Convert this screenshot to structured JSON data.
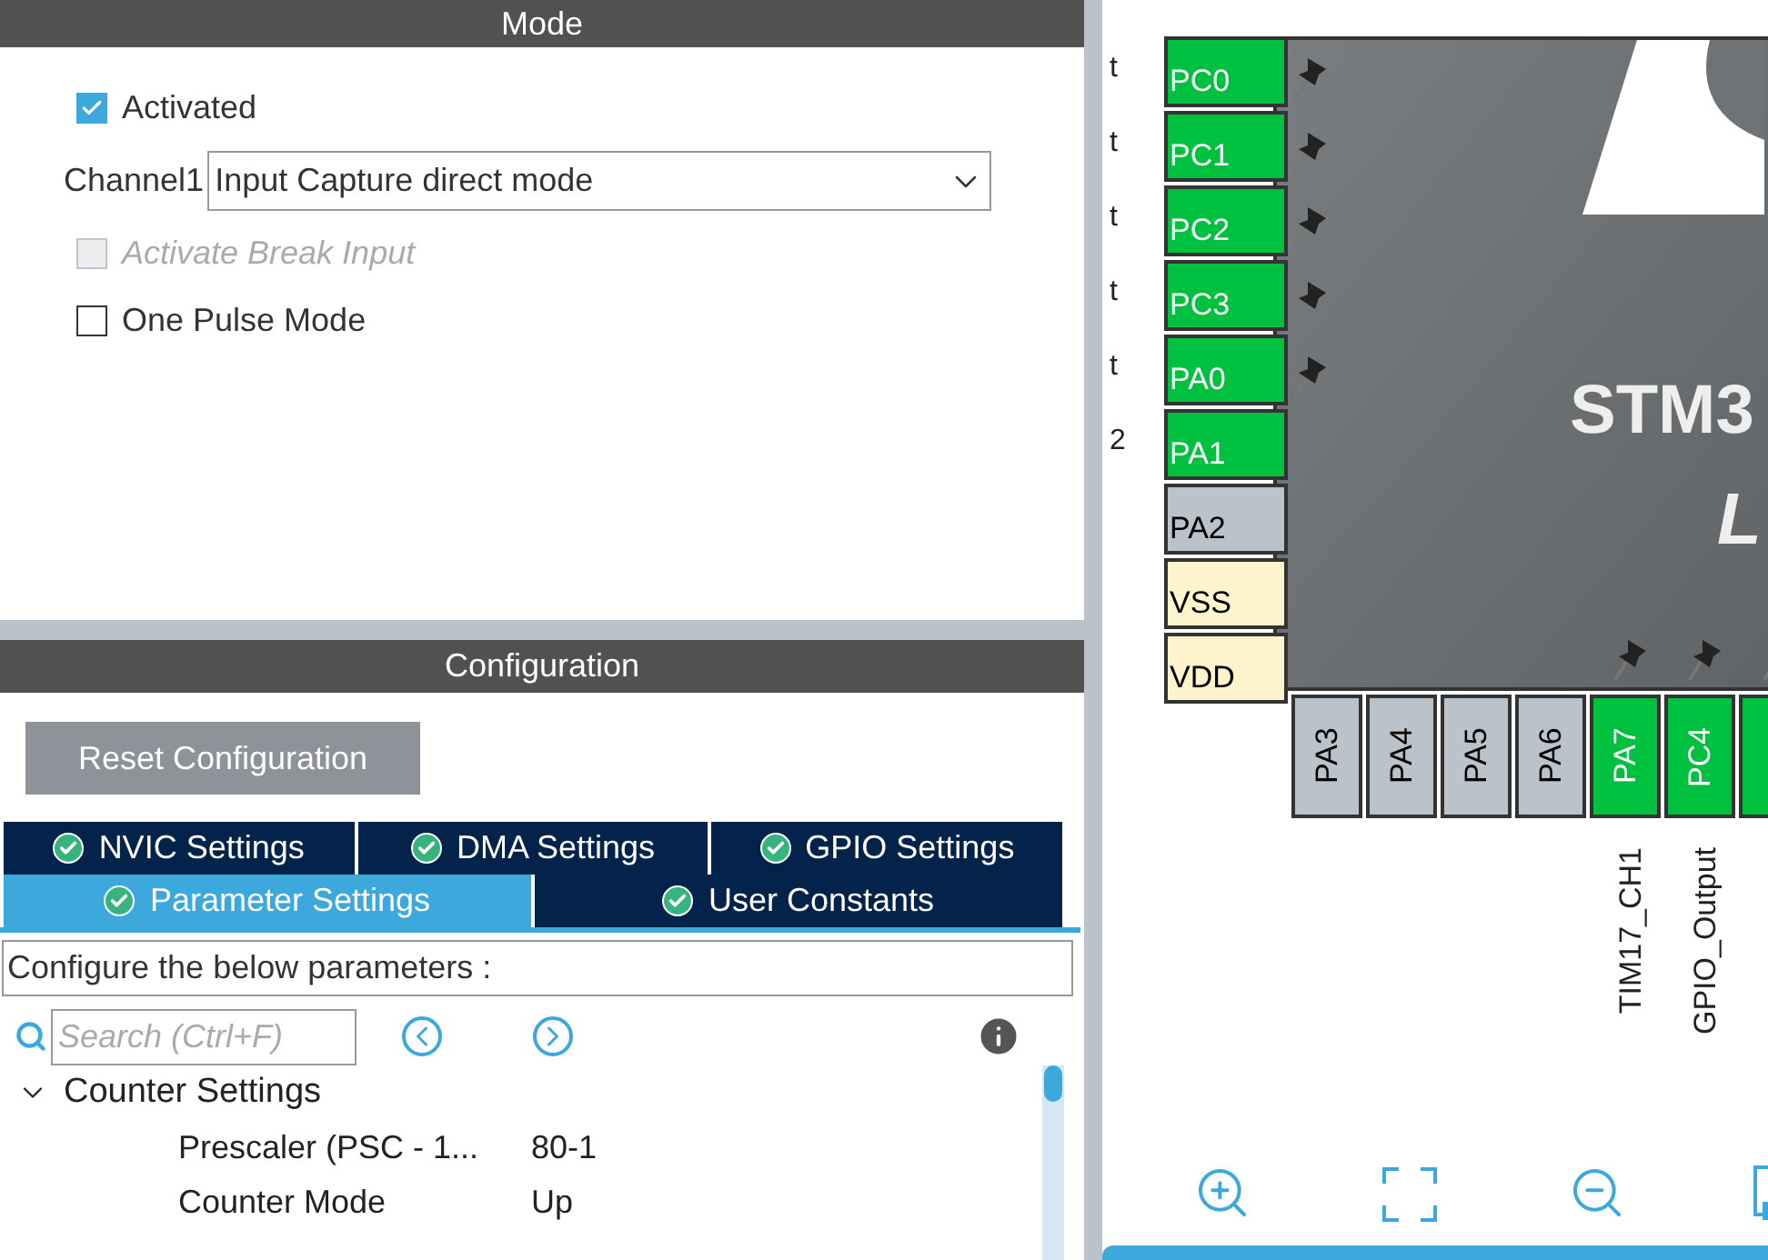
{
  "mode": {
    "title": "Mode",
    "activated": {
      "label": "Activated",
      "checked": true
    },
    "channel": {
      "label": "Channel1",
      "value": "Input Capture direct mode"
    },
    "options": [
      {
        "label": "Activate Break Input",
        "checked": false,
        "disabled": true
      },
      {
        "label": "One Pulse Mode",
        "checked": false,
        "disabled": false
      }
    ]
  },
  "configuration": {
    "title": "Configuration",
    "reset_button": "Reset Configuration",
    "tabs": [
      [
        {
          "label": "NVIC Settings",
          "selected": false
        },
        {
          "label": "DMA Settings",
          "selected": false
        },
        {
          "label": "GPIO Settings",
          "selected": false
        }
      ],
      [
        {
          "label": "Parameter Settings",
          "selected": true
        },
        {
          "label": "User Constants",
          "selected": false
        }
      ]
    ],
    "hint": "Configure the below parameters :",
    "search": {
      "placeholder": "Search (Ctrl+F)"
    },
    "tree": [
      {
        "label": "Counter Settings",
        "expanded": true,
        "children": [
          {
            "name": "Prescaler (PSC - 1...",
            "value": "80-1"
          },
          {
            "name": "Counter Mode",
            "value": "Up"
          }
        ]
      }
    ]
  },
  "pinout": {
    "chip_name": "STM3",
    "chip_line": "L",
    "left_pins": [
      {
        "name": "PC0",
        "signal": "t",
        "kind": "assigned",
        "pinned": true
      },
      {
        "name": "PC1",
        "signal": "t",
        "kind": "assigned",
        "pinned": true
      },
      {
        "name": "PC2",
        "signal": "t",
        "kind": "assigned",
        "pinned": true
      },
      {
        "name": "PC3",
        "signal": "t",
        "kind": "assigned",
        "pinned": true
      },
      {
        "name": "PA0",
        "signal": "t",
        "kind": "assigned",
        "pinned": true
      },
      {
        "name": "PA1",
        "signal": "2",
        "kind": "assigned"
      },
      {
        "name": "PA2",
        "kind": "free"
      },
      {
        "name": "VSS",
        "kind": "power"
      },
      {
        "name": "VDD",
        "kind": "power"
      }
    ],
    "bottom_pins": [
      {
        "name": "PA3",
        "kind": "free"
      },
      {
        "name": "PA4",
        "kind": "free"
      },
      {
        "name": "PA5",
        "kind": "free"
      },
      {
        "name": "PA6",
        "kind": "free"
      },
      {
        "name": "PA7",
        "signal": "TIM17_CH1",
        "kind": "assigned",
        "pinned": true
      },
      {
        "name": "PC4",
        "signal": "GPIO_Output",
        "kind": "assigned",
        "pinned": true
      },
      {
        "kind": "assigned",
        "pinned": true
      }
    ]
  }
}
